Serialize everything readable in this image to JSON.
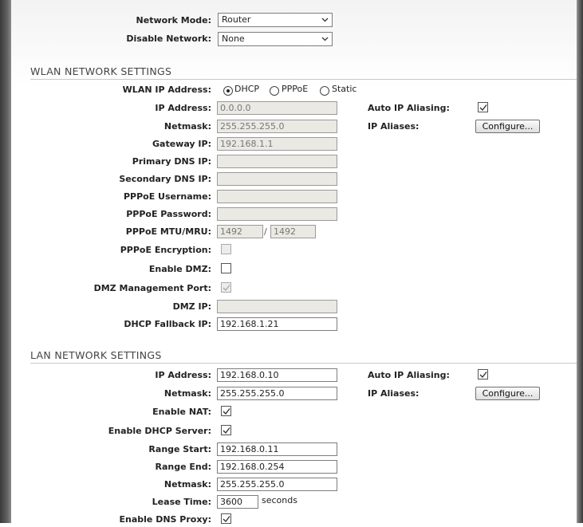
{
  "network": {
    "mode_label": "Network Mode:",
    "mode_value": "Router",
    "disable_label": "Disable Network:",
    "disable_value": "None"
  },
  "wlan": {
    "section_title": "WLAN NETWORK SETTINGS",
    "ip_address_mode_label": "WLAN IP Address:",
    "ip_modes": [
      "DHCP",
      "PPPoE",
      "Static"
    ],
    "ip_mode_selected": "DHCP",
    "ip_address_label": "IP Address:",
    "ip_address_value": "0.0.0.0",
    "netmask_label": "Netmask:",
    "netmask_value": "255.255.255.0",
    "gateway_label": "Gateway IP:",
    "gateway_value": "192.168.1.1",
    "primary_dns_label": "Primary DNS IP:",
    "primary_dns_value": "",
    "secondary_dns_label": "Secondary DNS IP:",
    "secondary_dns_value": "",
    "pppoe_username_label": "PPPoE Username:",
    "pppoe_username_value": "",
    "pppoe_password_label": "PPPoE Password:",
    "pppoe_password_value": "",
    "pppoe_mtu_label": "PPPoE MTU/MRU:",
    "pppoe_mtu_value": "1492",
    "pppoe_mru_value": "1492",
    "mtu_separator": "/",
    "pppoe_encryption_label": "PPPoE Encryption:",
    "pppoe_encryption_checked": false,
    "enable_dmz_label": "Enable DMZ:",
    "enable_dmz_checked": false,
    "dmz_mgmt_port_label": "DMZ Management Port:",
    "dmz_mgmt_port_checked": true,
    "dmz_ip_label": "DMZ IP:",
    "dmz_ip_value": "",
    "dhcp_fallback_label": "DHCP Fallback IP:",
    "dhcp_fallback_value": "192.168.1.21",
    "auto_ip_aliasing_label": "Auto IP Aliasing:",
    "auto_ip_aliasing_checked": true,
    "ip_aliases_label": "IP Aliases:",
    "configure_label": "Configure..."
  },
  "lan": {
    "section_title": "LAN NETWORK SETTINGS",
    "ip_address_label": "IP Address:",
    "ip_address_value": "192.168.0.10",
    "netmask_label": "Netmask:",
    "netmask_value": "255.255.255.0",
    "enable_nat_label": "Enable NAT:",
    "enable_nat_checked": true,
    "enable_dhcp_label": "Enable DHCP Server:",
    "enable_dhcp_checked": true,
    "range_start_label": "Range Start:",
    "range_start_value": "192.168.0.11",
    "range_end_label": "Range End:",
    "range_end_value": "192.168.0.254",
    "dhcp_netmask_label": "Netmask:",
    "dhcp_netmask_value": "255.255.255.0",
    "lease_time_label": "Lease Time:",
    "lease_time_value": "3600",
    "lease_time_unit": "seconds",
    "dns_proxy_label": "Enable DNS Proxy:",
    "dns_proxy_checked": true,
    "auto_ip_aliasing_label": "Auto IP Aliasing:",
    "auto_ip_aliasing_checked": true,
    "ip_aliases_label": "IP Aliases:",
    "configure_label": "Configure..."
  }
}
